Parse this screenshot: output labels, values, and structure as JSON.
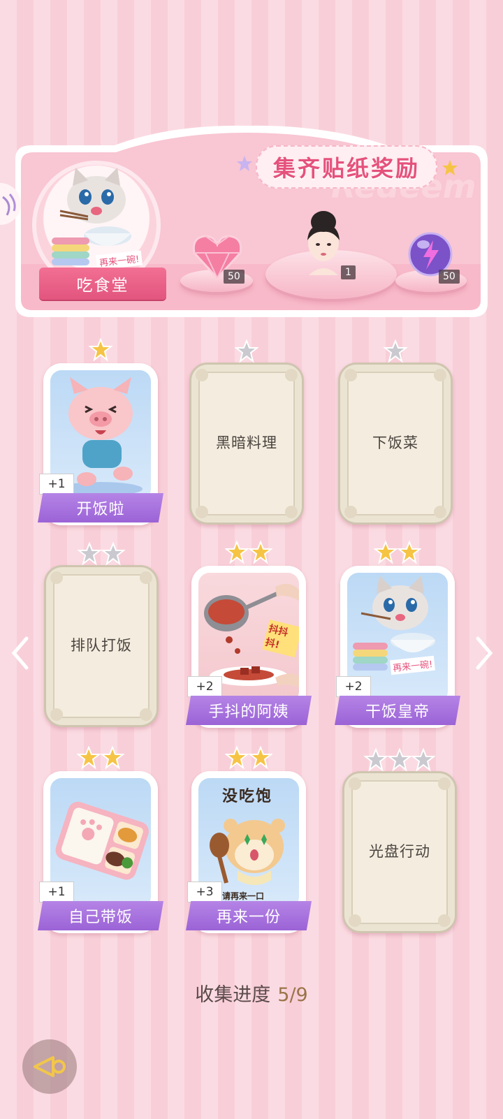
{
  "banner": {
    "title": "集齐贴纸奖励",
    "watermark": "Redeem",
    "medal_label": "吃食堂",
    "medal_sticker_text": "再来一碗!",
    "rewards": [
      {
        "name": "pink-diamond-heart",
        "count": "50"
      },
      {
        "name": "character-avatar",
        "count": "1"
      },
      {
        "name": "energy-orb",
        "count": "50"
      }
    ]
  },
  "cards": [
    {
      "name": "开饭啦",
      "unlocked": true,
      "stars": 1,
      "bonus": "+1",
      "art": "pig"
    },
    {
      "name": "黑暗料理",
      "unlocked": false,
      "stars": 1
    },
    {
      "name": "下饭菜",
      "unlocked": false,
      "stars": 1
    },
    {
      "name": "排队打饭",
      "unlocked": false,
      "stars": 2
    },
    {
      "name": "手抖的阿姨",
      "unlocked": true,
      "stars": 2,
      "bonus": "+2",
      "art": "ladle",
      "art_text": "抖抖抖!"
    },
    {
      "name": "干饭皇帝",
      "unlocked": true,
      "stars": 2,
      "bonus": "+2",
      "art": "cat",
      "art_text": "再来一碗!"
    },
    {
      "name": "自己带饭",
      "unlocked": true,
      "stars": 2,
      "bonus": "+1",
      "art": "bento"
    },
    {
      "name": "再来一份",
      "unlocked": true,
      "stars": 2,
      "bonus": "+3",
      "art": "hamster",
      "art_text_top": "没吃饱",
      "art_text_bottom": "请再来一口"
    },
    {
      "name": "光盘行动",
      "unlocked": false,
      "stars": 3
    }
  ],
  "progress": {
    "label": "收集进度",
    "value": "5/9"
  },
  "colors": {
    "gold_star": "#f6c445",
    "silver_star": "#c9c9cf",
    "name_bar": "#a46ddc",
    "title": "#e5527c"
  }
}
